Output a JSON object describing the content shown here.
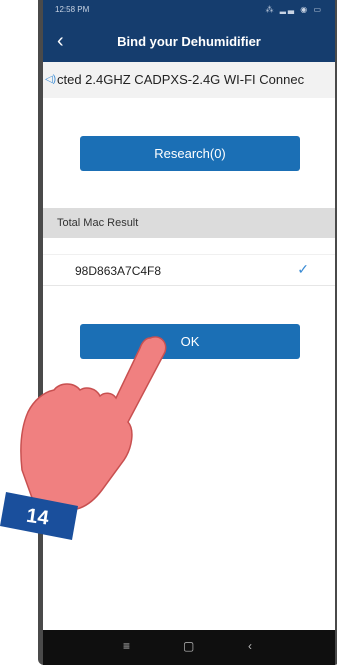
{
  "status_bar": {
    "time": "12:58 PM",
    "icons": "⁂ ▂▃ ◉ ▭"
  },
  "header": {
    "title": "Bind your Dehumidifier",
    "back_icon": "chevron-left-icon"
  },
  "marquee": {
    "text": "cted 2.4GHZ CADPXS-2.4G   WI-FI Connec",
    "icon": "speaker-icon"
  },
  "research_button": {
    "label": "Research(0)"
  },
  "section": {
    "title": "Total Mac Result"
  },
  "results": [
    {
      "mac": "98D863A7C4F8",
      "selected": true
    }
  ],
  "ok_button": {
    "label": "OK"
  },
  "navbar": {
    "menu": "≡",
    "home": "▢",
    "back": "‹"
  },
  "annotation": {
    "step_number": "14"
  },
  "colors": {
    "header": "#153d6e",
    "button": "#1b6fb5",
    "check": "#3a8bd4",
    "hand": "#f08080",
    "badge": "#1a4f9c"
  }
}
